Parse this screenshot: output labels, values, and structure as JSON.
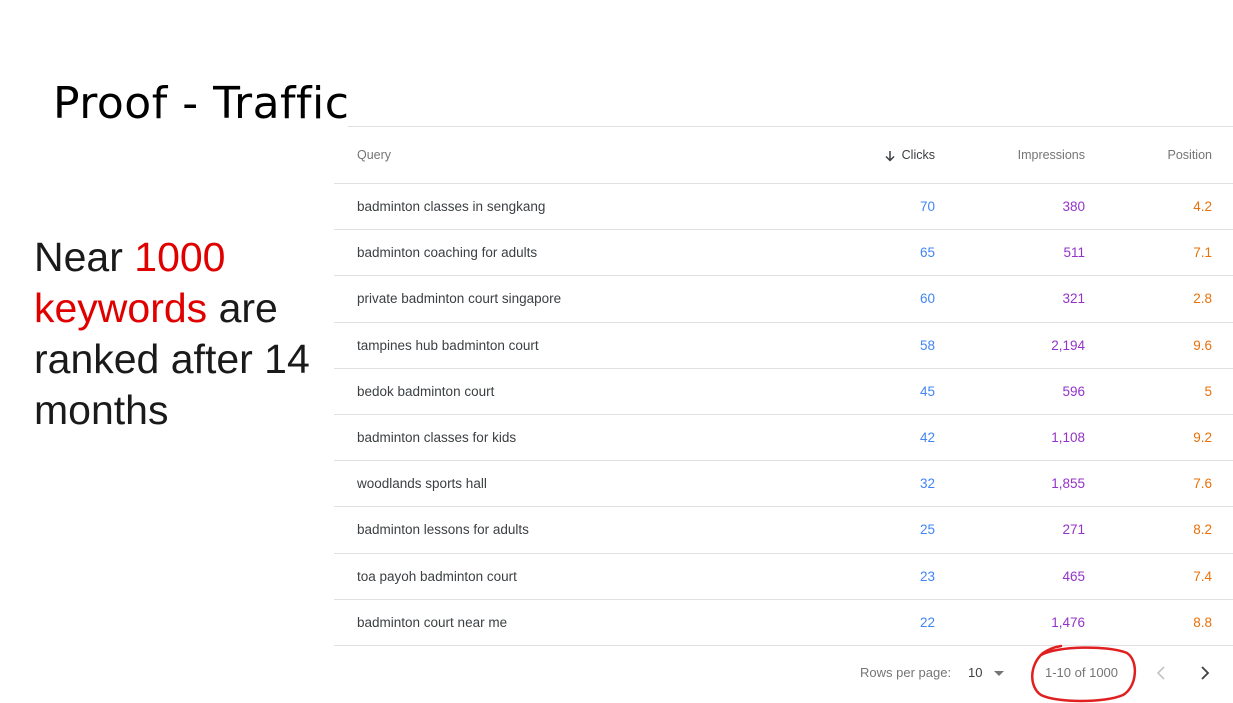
{
  "slide": {
    "title": "Proof - Traffic",
    "headline": {
      "part1": "Near ",
      "highlight1": "1000",
      "highlight2": "keywords",
      "part2": " are ranked after 14 months"
    }
  },
  "table": {
    "headers": {
      "query": "Query",
      "clicks": "Clicks",
      "impressions": "Impressions",
      "position": "Position"
    },
    "rows": [
      {
        "query": "badminton classes in sengkang",
        "clicks": "70",
        "impressions": "380",
        "position": "4.2"
      },
      {
        "query": "badminton coaching for adults",
        "clicks": "65",
        "impressions": "511",
        "position": "7.1"
      },
      {
        "query": "private badminton court singapore",
        "clicks": "60",
        "impressions": "321",
        "position": "2.8"
      },
      {
        "query": "tampines hub badminton court",
        "clicks": "58",
        "impressions": "2,194",
        "position": "9.6"
      },
      {
        "query": "bedok badminton court",
        "clicks": "45",
        "impressions": "596",
        "position": "5"
      },
      {
        "query": "badminton classes for kids",
        "clicks": "42",
        "impressions": "1,108",
        "position": "9.2"
      },
      {
        "query": "woodlands sports hall",
        "clicks": "32",
        "impressions": "1,855",
        "position": "7.6"
      },
      {
        "query": "badminton lessons for adults",
        "clicks": "25",
        "impressions": "271",
        "position": "8.2"
      },
      {
        "query": "toa payoh badminton court",
        "clicks": "23",
        "impressions": "465",
        "position": "7.4"
      },
      {
        "query": "badminton court near me",
        "clicks": "22",
        "impressions": "1,476",
        "position": "8.8"
      }
    ]
  },
  "pagination": {
    "rows_per_page_label": "Rows per page:",
    "rows_per_page_value": "10",
    "range": "1-10 of 1000"
  },
  "colors": {
    "clicks": "#4285f4",
    "impressions": "#9334c8",
    "position": "#e8710a",
    "highlight": "#e00000",
    "annotation_circle": "#e02020"
  },
  "icons": {
    "sort": "arrow-down-icon",
    "dropdown": "caret-down-icon",
    "prev": "chevron-left-icon",
    "next": "chevron-right-icon"
  }
}
